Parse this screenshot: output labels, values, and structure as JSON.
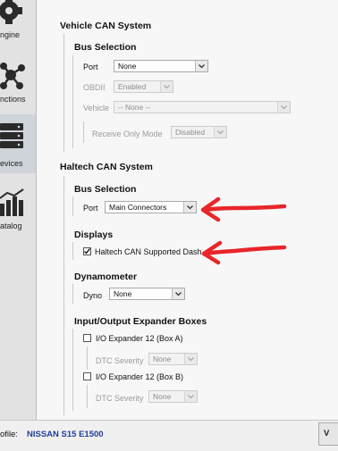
{
  "sidebar": {
    "items": [
      {
        "label": "ngine",
        "icon": "gear-icon"
      },
      {
        "label": "nctions",
        "icon": "nodes-icon"
      },
      {
        "label": "evices",
        "icon": "devices-icon"
      },
      {
        "label": "atalog",
        "icon": "bar-chart-icon"
      }
    ]
  },
  "vehicle_can": {
    "title": "Vehicle CAN System",
    "bus_selection": "Bus Selection",
    "port_label": "Port",
    "port_value": "None",
    "obdii_label": "OBDII",
    "obdii_value": "Enabled",
    "vehicle_label": "Vehicle",
    "vehicle_value": "-- None --",
    "receive_label": "Receive Only Mode",
    "receive_value": "Disabled"
  },
  "haltech_can": {
    "title": "Haltech CAN System",
    "bus_selection": "Bus Selection",
    "port_label": "Port",
    "port_value": "Main Connectors",
    "displays_title": "Displays",
    "supported_dash_label": "Haltech CAN Supported Dash",
    "supported_dash_checked": true,
    "dyno_title": "Dynamometer",
    "dyno_label": "Dyno",
    "dyno_value": "None",
    "io_title": "Input/Output Expander Boxes",
    "io_a_label": "I/O Expander 12 (Box A)",
    "io_a_dtc_label": "DTC Severity",
    "io_a_dtc_value": "None",
    "io_b_label": "I/O Expander 12 (Box B)",
    "io_b_dtc_label": "DTC Severity",
    "io_b_dtc_value": "None"
  },
  "status_bar": {
    "profile_label": "ofile:",
    "profile_value": "NISSAN S15 E1500",
    "button_label": "V"
  },
  "colors": {
    "annotation_arrow": "#e8262b",
    "profile_text": "#1f3f9a"
  }
}
